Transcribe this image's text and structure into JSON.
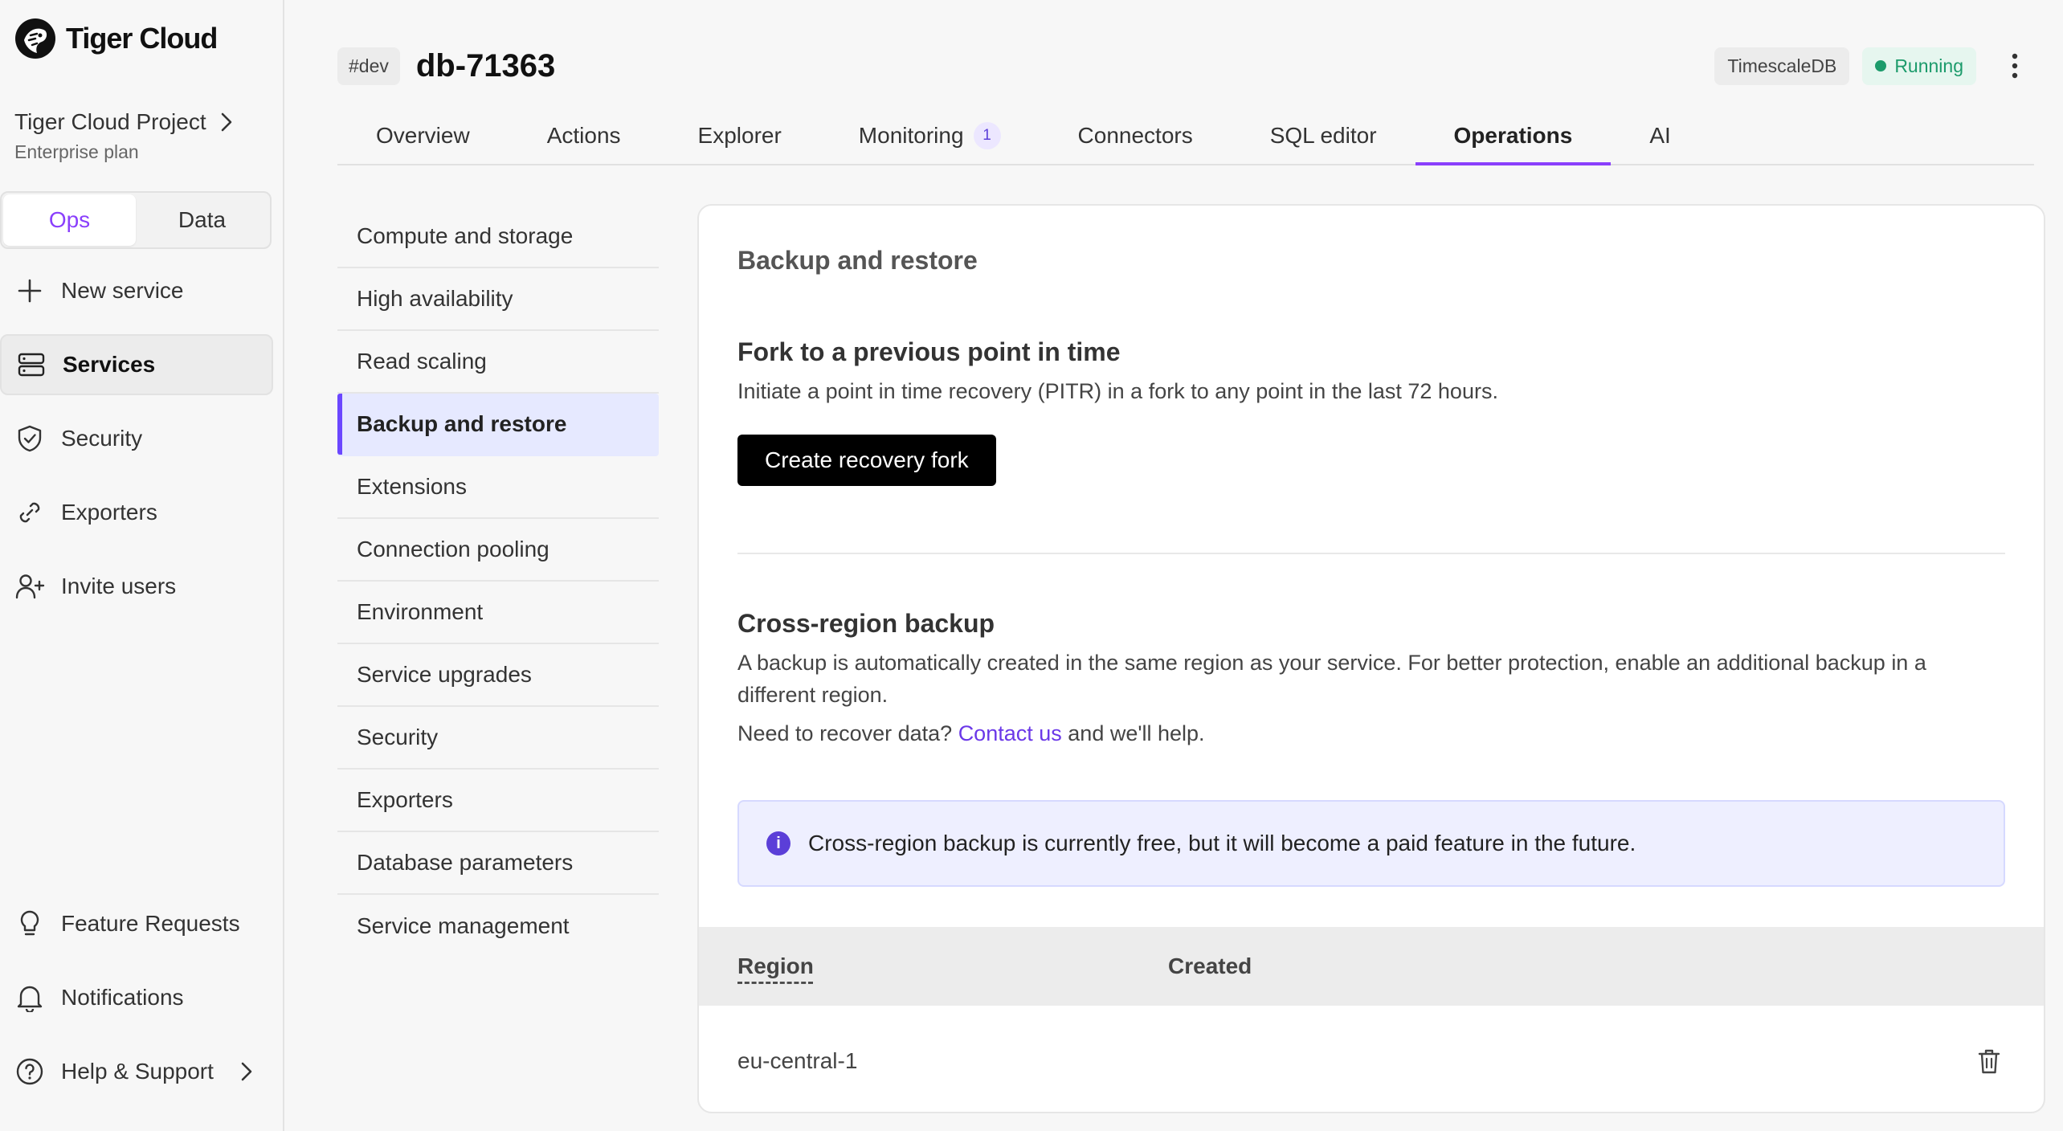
{
  "brand": {
    "name": "Tiger Cloud"
  },
  "project": {
    "name": "Tiger Cloud Project",
    "plan": "Enterprise plan"
  },
  "mode_switch": {
    "ops": "Ops",
    "data": "Data",
    "active": "Ops"
  },
  "nav": {
    "new_service": "New service",
    "services": "Services",
    "security": "Security",
    "exporters": "Exporters",
    "invite_users": "Invite users",
    "feature_requests": "Feature Requests",
    "notifications": "Notifications",
    "help_support": "Help & Support"
  },
  "header": {
    "env_tag": "#dev",
    "title": "db-71363",
    "db_type": "TimescaleDB",
    "status": "Running"
  },
  "tabs": [
    {
      "label": "Overview"
    },
    {
      "label": "Actions"
    },
    {
      "label": "Explorer"
    },
    {
      "label": "Monitoring",
      "badge": "1"
    },
    {
      "label": "Connectors"
    },
    {
      "label": "SQL editor"
    },
    {
      "label": "Operations",
      "active": true
    },
    {
      "label": "AI"
    }
  ],
  "submenu": [
    "Compute and storage",
    "High availability",
    "Read scaling",
    "Backup and restore",
    "Extensions",
    "Connection pooling",
    "Environment",
    "Service upgrades",
    "Security",
    "Exporters",
    "Database parameters",
    "Service management"
  ],
  "submenu_active": "Backup and restore",
  "card": {
    "title": "Backup and restore",
    "fork": {
      "title": "Fork to a previous point in time",
      "desc": "Initiate a point in time recovery (PITR) in a fork to any point in the last 72 hours.",
      "button": "Create recovery fork"
    },
    "cross_region": {
      "title": "Cross-region backup",
      "desc": "A backup is automatically created in the same region as your service. For better protection, enable an additional backup in a different region.",
      "recover_prefix": "Need to recover data?",
      "contact_link": "Contact us",
      "recover_suffix": "and we'll help."
    },
    "info": "Cross-region backup is currently free, but it will become a paid feature in the future.",
    "table": {
      "columns": [
        "Region",
        "Created"
      ],
      "rows": [
        {
          "region": "eu-central-1",
          "created": ""
        }
      ]
    }
  },
  "colors": {
    "accent": "#8a3ffc",
    "running": "#1c9b6b",
    "link": "#6b38e8",
    "info_bg": "#eeefff"
  }
}
